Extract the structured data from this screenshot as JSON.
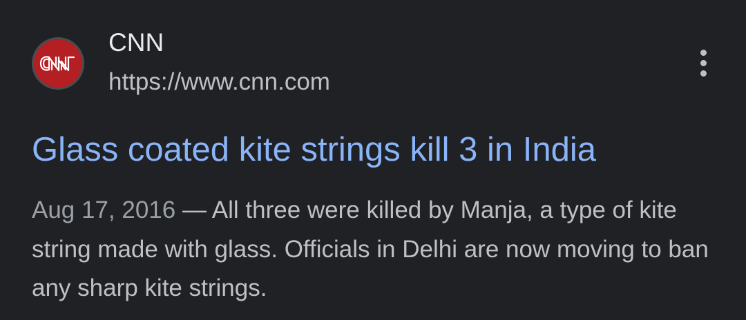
{
  "source": {
    "name": "CNN",
    "url": "https://www.cnn.com",
    "favicon_icon": "cnn-logo-icon",
    "favicon_text": "CNN",
    "favicon_color": "#b31f22"
  },
  "more_icon": "more-vert-icon",
  "result": {
    "title": "Glass coated kite strings kill 3 in India",
    "date": "Aug 17, 2016",
    "separator": " — ",
    "snippet": "All three were killed by Manja, a type of kite string made with glass. Officials in Delhi are now moving to ban any sharp kite strings."
  },
  "colors": {
    "background": "#202124",
    "title": "#8ab4f8",
    "text": "#bdc1c6",
    "site_name": "#e8eaed"
  }
}
